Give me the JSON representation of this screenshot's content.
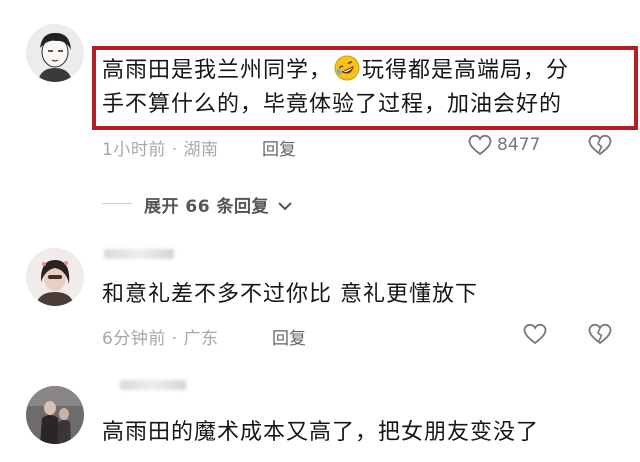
{
  "comments": [
    {
      "text_before_emoji": "高雨田是我兰州同学，",
      "emoji": "rolling-on-floor-laughing",
      "text_after_emoji": "玩得都是高端局，分",
      "text_line2": "手不算什么的，毕竟体验了过程，加油会好的",
      "time": "1小时前",
      "separator": "·",
      "location": "湖南",
      "reply_label": "回复",
      "like_count": "8477",
      "expand_label": "展开 66 条回复"
    },
    {
      "text": "和意礼差不多不过你比 意礼更懂放下",
      "time": "6分钟前",
      "separator": "·",
      "location": "广东",
      "reply_label": "回复"
    },
    {
      "text": "高雨田的魔术成本又高了，把女朋友变没了"
    }
  ],
  "colors": {
    "highlight_border": "#b31e23",
    "meta_text": "#a8a8a8"
  }
}
